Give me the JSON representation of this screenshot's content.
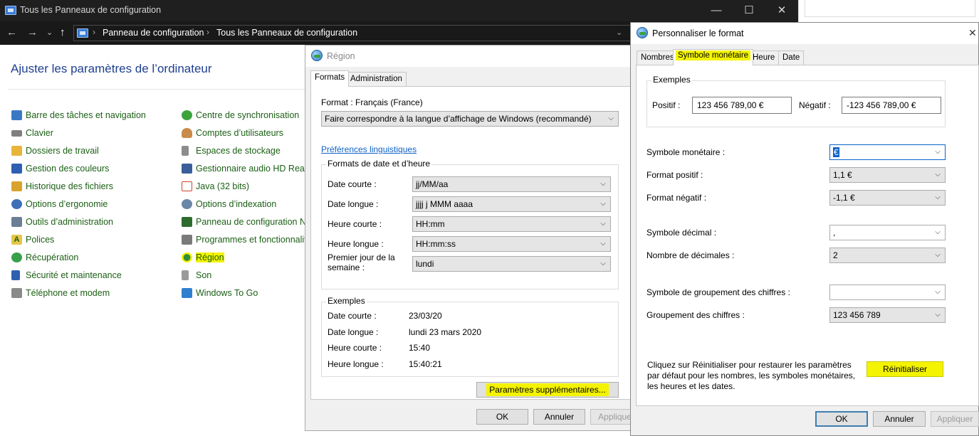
{
  "control_panel": {
    "window_title": "Tous les Panneaux de configuration",
    "controls": {
      "minimize": "—",
      "maximize": "☐",
      "close": "✕"
    },
    "nav": {
      "back": "←",
      "forward": "→",
      "recent": "⌄",
      "up": "↑"
    },
    "breadcrumb": [
      "Panneau de configuration",
      "Tous les Panneaux de configuration"
    ],
    "heading": "Ajuster les paramètres de l’ordinateur",
    "items_left": [
      {
        "label": "Barre des tâches et navigation",
        "icon": "taskbar-icon",
        "color": "#3b78c4"
      },
      {
        "label": "Clavier",
        "icon": "keyboard-icon",
        "color": "#7f7f7f"
      },
      {
        "label": "Dossiers de travail",
        "icon": "work-folders-icon",
        "color": "#e8b53a"
      },
      {
        "label": "Gestion des couleurs",
        "icon": "color-management-icon",
        "color": "#2e5fb3"
      },
      {
        "label": "Historique des fichiers",
        "icon": "file-history-icon",
        "color": "#d9a22c"
      },
      {
        "label": "Options d’ergonomie",
        "icon": "ease-of-access-icon",
        "color": "#3e6fb8"
      },
      {
        "label": "Outils d’administration",
        "icon": "admin-tools-icon",
        "color": "#6a7f95"
      },
      {
        "label": "Polices",
        "icon": "fonts-icon",
        "color": "#e7c54a"
      },
      {
        "label": "Récupération",
        "icon": "recovery-icon",
        "color": "#39a04a"
      },
      {
        "label": "Sécurité et maintenance",
        "icon": "flag-icon",
        "color": "#2f5fb0"
      },
      {
        "label": "Téléphone et modem",
        "icon": "phone-modem-icon",
        "color": "#8a8a8a"
      }
    ],
    "items_right": [
      {
        "label": "Centre de synchronisation",
        "icon": "sync-center-icon",
        "color": "#3ca33c"
      },
      {
        "label": "Comptes d’utilisateurs",
        "icon": "user-accounts-icon",
        "color": "#c98b4a"
      },
      {
        "label": "Espaces de stockage",
        "icon": "storage-spaces-icon",
        "color": "#8c8c8c"
      },
      {
        "label": "Gestionnaire audio HD Realte",
        "icon": "audio-manager-icon",
        "color": "#3a5e9a"
      },
      {
        "label": "Java (32 bits)",
        "icon": "java-icon",
        "color": "#d2452c"
      },
      {
        "label": "Options d’indexation",
        "icon": "indexing-icon",
        "color": "#6b86a8"
      },
      {
        "label": "Panneau de configuration NV",
        "icon": "nvidia-icon",
        "color": "#2e6b2e"
      },
      {
        "label": "Programmes et fonctionnalit",
        "icon": "programs-icon",
        "color": "#7a7a7a"
      },
      {
        "label": "Région",
        "icon": "region-globe-icon",
        "color": "#2f8f3a",
        "highlight": true
      },
      {
        "label": "Son",
        "icon": "speaker-icon",
        "color": "#9a9a9a"
      },
      {
        "label": "Windows To Go",
        "icon": "windows-to-go-icon",
        "color": "#2f7fd0"
      }
    ]
  },
  "region_dialog": {
    "title": "Région",
    "tabs": [
      "Formats",
      "Administration"
    ],
    "format_label": "Format : Français (France)",
    "format_value": "Faire correspondre à la langue d’affichage de Windows (recommandé)",
    "lang_prefs_link": "Préférences linguistiques",
    "datetime_group": "Formats de date et d’heure",
    "datetime_rows": [
      {
        "label": "Date courte :",
        "value": "jj/MM/aa"
      },
      {
        "label": "Date longue :",
        "value": "jjjj j MMM aaaa"
      },
      {
        "label": "Heure courte :",
        "value": "HH:mm"
      },
      {
        "label": "Heure longue :",
        "value": "HH:mm:ss"
      },
      {
        "label": "Premier jour de la semaine :",
        "value": "lundi"
      }
    ],
    "examples_group": "Exemples",
    "examples": [
      {
        "label": "Date courte :",
        "value": "23/03/20"
      },
      {
        "label": "Date longue :",
        "value": "lundi 23 mars 2020"
      },
      {
        "label": "Heure courte :",
        "value": "15:40"
      },
      {
        "label": "Heure longue :",
        "value": "15:40:21"
      }
    ],
    "more_settings": "Paramètres supplémentaires...",
    "ok": "OK",
    "cancel": "Annuler",
    "apply": "Appliquer"
  },
  "customize_dialog": {
    "title": "Personnaliser le format",
    "close": "✕",
    "tabs": [
      "Nombres",
      "Symbole monétaire",
      "Heure",
      "Date"
    ],
    "examples_group": "Exemples",
    "positive_label": "Positif :",
    "positive_value": "123 456 789,00 €",
    "negative_label": "Négatif :",
    "negative_value": "-123 456 789,00 €",
    "rows": [
      {
        "label": "Symbole monétaire :",
        "value": "€"
      },
      {
        "label": "Format positif :",
        "value": "1,1 €"
      },
      {
        "label": "Format négatif :",
        "value": "-1,1 €"
      },
      {
        "label": "Symbole décimal :",
        "value": ","
      },
      {
        "label": "Nombre de décimales :",
        "value": "2"
      },
      {
        "label": "Symbole de groupement des chiffres :",
        "value": ""
      },
      {
        "label": "Groupement des chiffres :",
        "value": "123 456 789"
      }
    ],
    "reset_info": "Cliquez sur Réinitialiser pour restaurer les paramètres par défaut pour les nombres, les symboles monétaires, les heures et les dates.",
    "reset": "Réinitialiser",
    "ok": "OK",
    "cancel": "Annuler",
    "apply": "Appliquer"
  },
  "colors": {
    "highlight": "#f4f300",
    "link_green": "#1b5f14",
    "heading_blue": "#1e3f8f"
  }
}
